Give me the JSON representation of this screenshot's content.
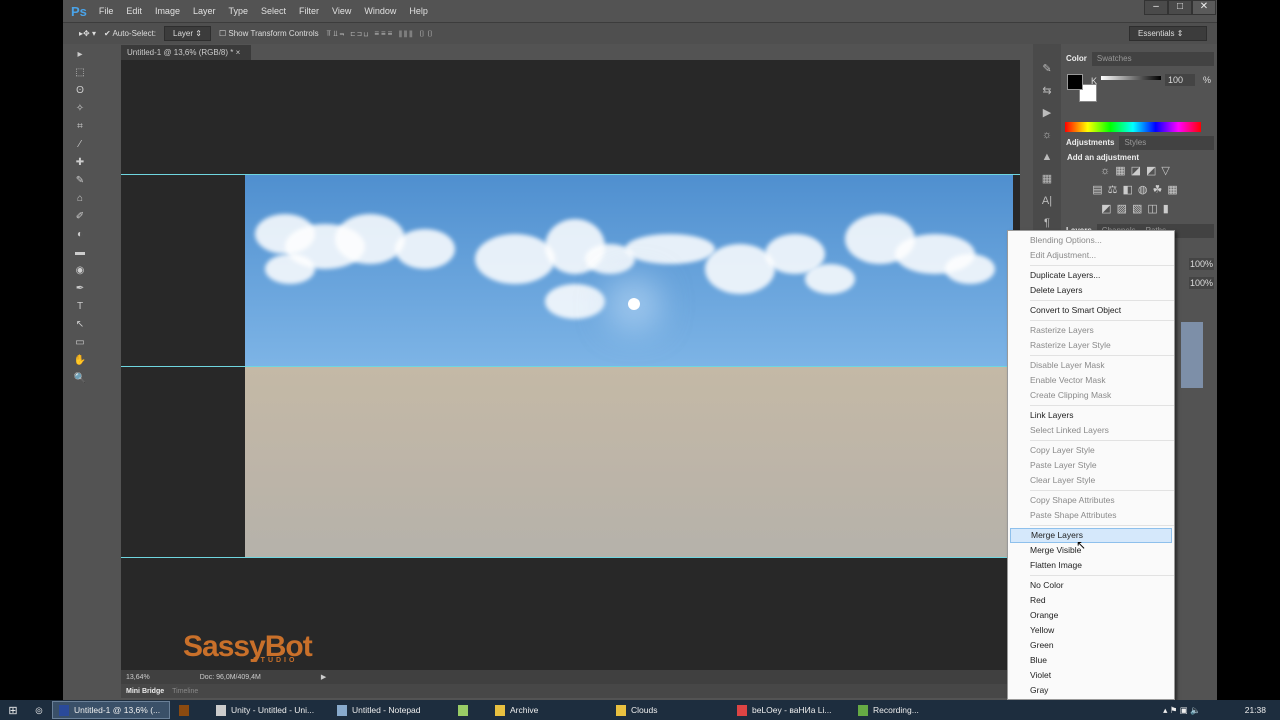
{
  "app": {
    "logo": "Ps",
    "menu": [
      "File",
      "Edit",
      "Image",
      "Layer",
      "Type",
      "Select",
      "Filter",
      "View",
      "Window",
      "Help"
    ],
    "window_controls": [
      "–",
      "□",
      "✕"
    ]
  },
  "options": {
    "auto_select": "Auto-Select:",
    "auto_select_mode": "Layer",
    "show_transform": "Show Transform Controls",
    "workspace": "Essentials"
  },
  "document": {
    "tab": "Untitled-1 @ 13,6% (RGB/8) *",
    "close": "×",
    "zoom": "13,64%",
    "doc_size": "Doc: 96,0M/409,4M"
  },
  "bottom_tabs": [
    "Mini Bridge",
    "Timeline"
  ],
  "watermark": {
    "name": "SassyBot",
    "sub": "STUDIO"
  },
  "panels": {
    "color": {
      "tabs": [
        "Color",
        "Swatches"
      ],
      "channel": "K",
      "value": "100",
      "unit": "%"
    },
    "adjustments": {
      "tabs": [
        "Adjustments",
        "Styles"
      ],
      "title": "Add an adjustment"
    },
    "layers": {
      "tabs": [
        "Layers",
        "Channels",
        "Paths"
      ],
      "opacity": "100%",
      "fill": "100%"
    }
  },
  "context_menu": [
    {
      "label": "Blending Options...",
      "disabled": true
    },
    {
      "label": "Edit Adjustment...",
      "disabled": true
    },
    {
      "sep": true
    },
    {
      "label": "Duplicate Layers..."
    },
    {
      "label": "Delete Layers"
    },
    {
      "sep": true
    },
    {
      "label": "Convert to Smart Object"
    },
    {
      "sep": true
    },
    {
      "label": "Rasterize Layers",
      "disabled": true
    },
    {
      "label": "Rasterize Layer Style",
      "disabled": true
    },
    {
      "sep": true
    },
    {
      "label": "Disable Layer Mask",
      "disabled": true
    },
    {
      "label": "Enable Vector Mask",
      "disabled": true
    },
    {
      "label": "Create Clipping Mask",
      "disabled": true
    },
    {
      "sep": true
    },
    {
      "label": "Link Layers"
    },
    {
      "label": "Select Linked Layers",
      "disabled": true
    },
    {
      "sep": true
    },
    {
      "label": "Copy Layer Style",
      "disabled": true
    },
    {
      "label": "Paste Layer Style",
      "disabled": true
    },
    {
      "label": "Clear Layer Style",
      "disabled": true
    },
    {
      "sep": true
    },
    {
      "label": "Copy Shape Attributes",
      "disabled": true
    },
    {
      "label": "Paste Shape Attributes",
      "disabled": true
    },
    {
      "sep": true
    },
    {
      "label": "Merge Layers",
      "highlighted": true
    },
    {
      "label": "Merge Visible"
    },
    {
      "label": "Flatten Image"
    },
    {
      "sep": true
    },
    {
      "label": "No Color"
    },
    {
      "label": "Red"
    },
    {
      "label": "Orange"
    },
    {
      "label": "Yellow"
    },
    {
      "label": "Green"
    },
    {
      "label": "Blue"
    },
    {
      "label": "Violet"
    },
    {
      "label": "Gray"
    }
  ],
  "taskbar": {
    "items": [
      {
        "label": "Untitled-1 @ 13,6% (...",
        "active": true,
        "color": "#2a4a9a"
      },
      {
        "label": "",
        "color": "#8a4a10"
      },
      {
        "label": "Unity - Untitled - Uni...",
        "color": "#ccc"
      },
      {
        "label": "Untitled - Notepad",
        "color": "#8ac"
      },
      {
        "label": "",
        "color": "#9c6"
      },
      {
        "label": "Archive",
        "color": "#e8c040"
      },
      {
        "label": "Clouds",
        "color": "#e8c040"
      },
      {
        "label": "beLOey - ваНИа Li...",
        "color": "#d44"
      },
      {
        "label": "Recording...",
        "color": "#6a4"
      }
    ],
    "clock": "21:38"
  },
  "colors": {
    "accent_guide": "#6fd6e0",
    "menu_highlight": "#d5e8fb",
    "watermark": "#c9702a"
  }
}
